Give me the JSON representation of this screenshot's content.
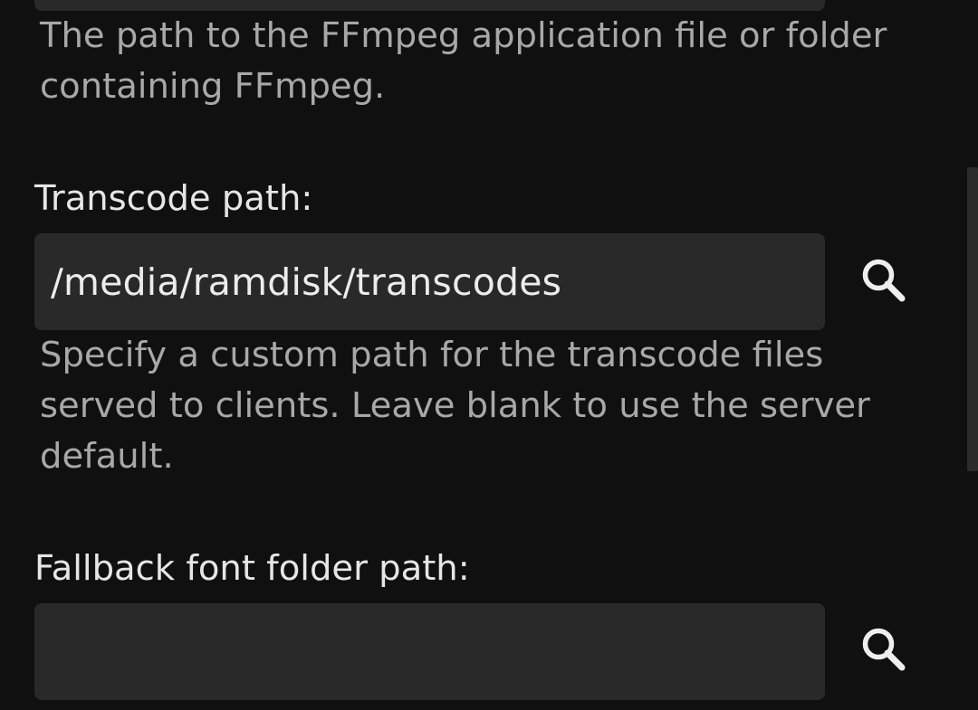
{
  "ffmpeg": {
    "help": "The path to the FFmpeg application file or folder containing FFmpeg."
  },
  "transcode": {
    "label": "Transcode path:",
    "value": "/media/ramdisk/transcodes",
    "help": "Specify a custom path for the transcode files served to clients. Leave blank to use the server default.",
    "search_icon": "search-icon"
  },
  "fallback_font": {
    "label": "Fallback font folder path:",
    "value": "",
    "search_icon": "search-icon"
  },
  "colors": {
    "background": "#101010",
    "input_background": "#292929",
    "label_text": "#e6e6e6",
    "help_text": "#a8a8a8",
    "icon": "#eeeeee"
  }
}
